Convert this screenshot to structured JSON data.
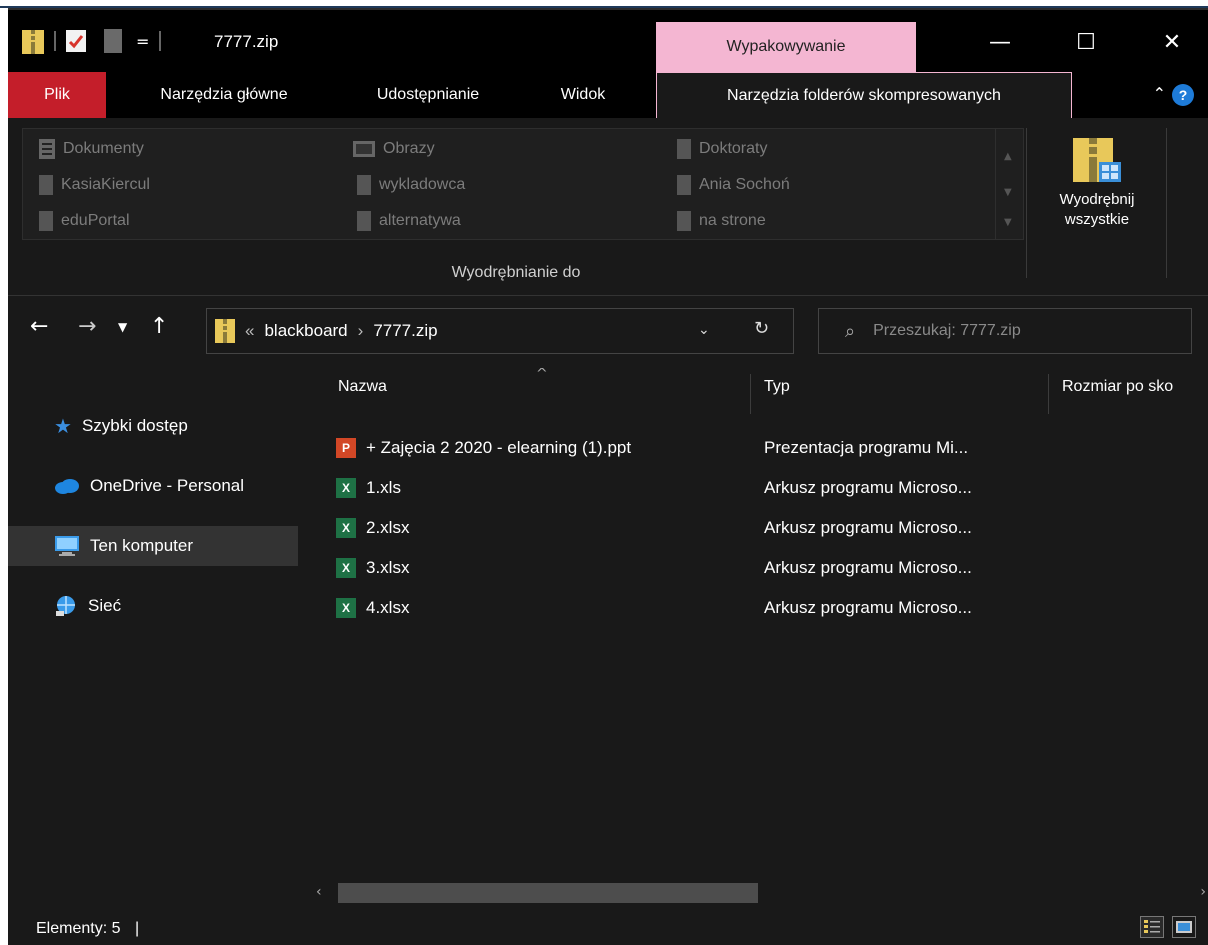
{
  "window": {
    "title": "7777.zip",
    "context_tab_header": "Wypakowywanie",
    "controls": {
      "minimize": "—",
      "maximize": "☐",
      "close": "✕"
    }
  },
  "ribbon": {
    "tabs": [
      "Plik",
      "Narzędzia główne",
      "Udostępnianie",
      "Widok",
      "Narzędzia folderów skompresowanych"
    ],
    "destinations": [
      [
        "Dokumenty",
        "Obrazy",
        "Doktoraty"
      ],
      [
        "KasiaKiercul",
        "wykladowca",
        "Ania Sochoń"
      ],
      [
        "eduPortal",
        "alternatywa",
        "na strone"
      ]
    ],
    "group_label": "Wyodrębnianie do",
    "extract_all": {
      "line1": "Wyodrębnij",
      "line2": "wszystkie"
    },
    "help": "?"
  },
  "address": {
    "prefix": "«",
    "crumbs": [
      "blackboard",
      "7777.zip"
    ],
    "search_placeholder": "Przeszukaj: 7777.zip"
  },
  "nav": {
    "items": [
      {
        "label": "Szybki dostęp",
        "icon": "star-icon",
        "selected": false
      },
      {
        "label": "OneDrive - Personal",
        "icon": "cloud-icon",
        "selected": false
      },
      {
        "label": "Ten komputer",
        "icon": "computer-icon",
        "selected": true
      },
      {
        "label": "Sieć",
        "icon": "network-icon",
        "selected": false
      }
    ]
  },
  "files": {
    "columns": [
      "Nazwa",
      "Typ",
      "Rozmiar po sko"
    ],
    "rows": [
      {
        "name": "+ Zajęcia 2 2020 - elearning (1).ppt",
        "type": "Prezentacja programu Mi...",
        "icon": "powerpoint-icon"
      },
      {
        "name": "1.xls",
        "type": "Arkusz programu Microso...",
        "icon": "excel-icon"
      },
      {
        "name": "2.xlsx",
        "type": "Arkusz programu Microso...",
        "icon": "excel-icon"
      },
      {
        "name": "3.xlsx",
        "type": "Arkusz programu Microso...",
        "icon": "excel-icon"
      },
      {
        "name": "4.xlsx",
        "type": "Arkusz programu Microso...",
        "icon": "excel-icon"
      }
    ]
  },
  "status": {
    "text": "Elementy: 5"
  },
  "colors": {
    "accent_pink": "#f4b6d2",
    "file_tab_red": "#c41e2a",
    "background": "#191919"
  }
}
